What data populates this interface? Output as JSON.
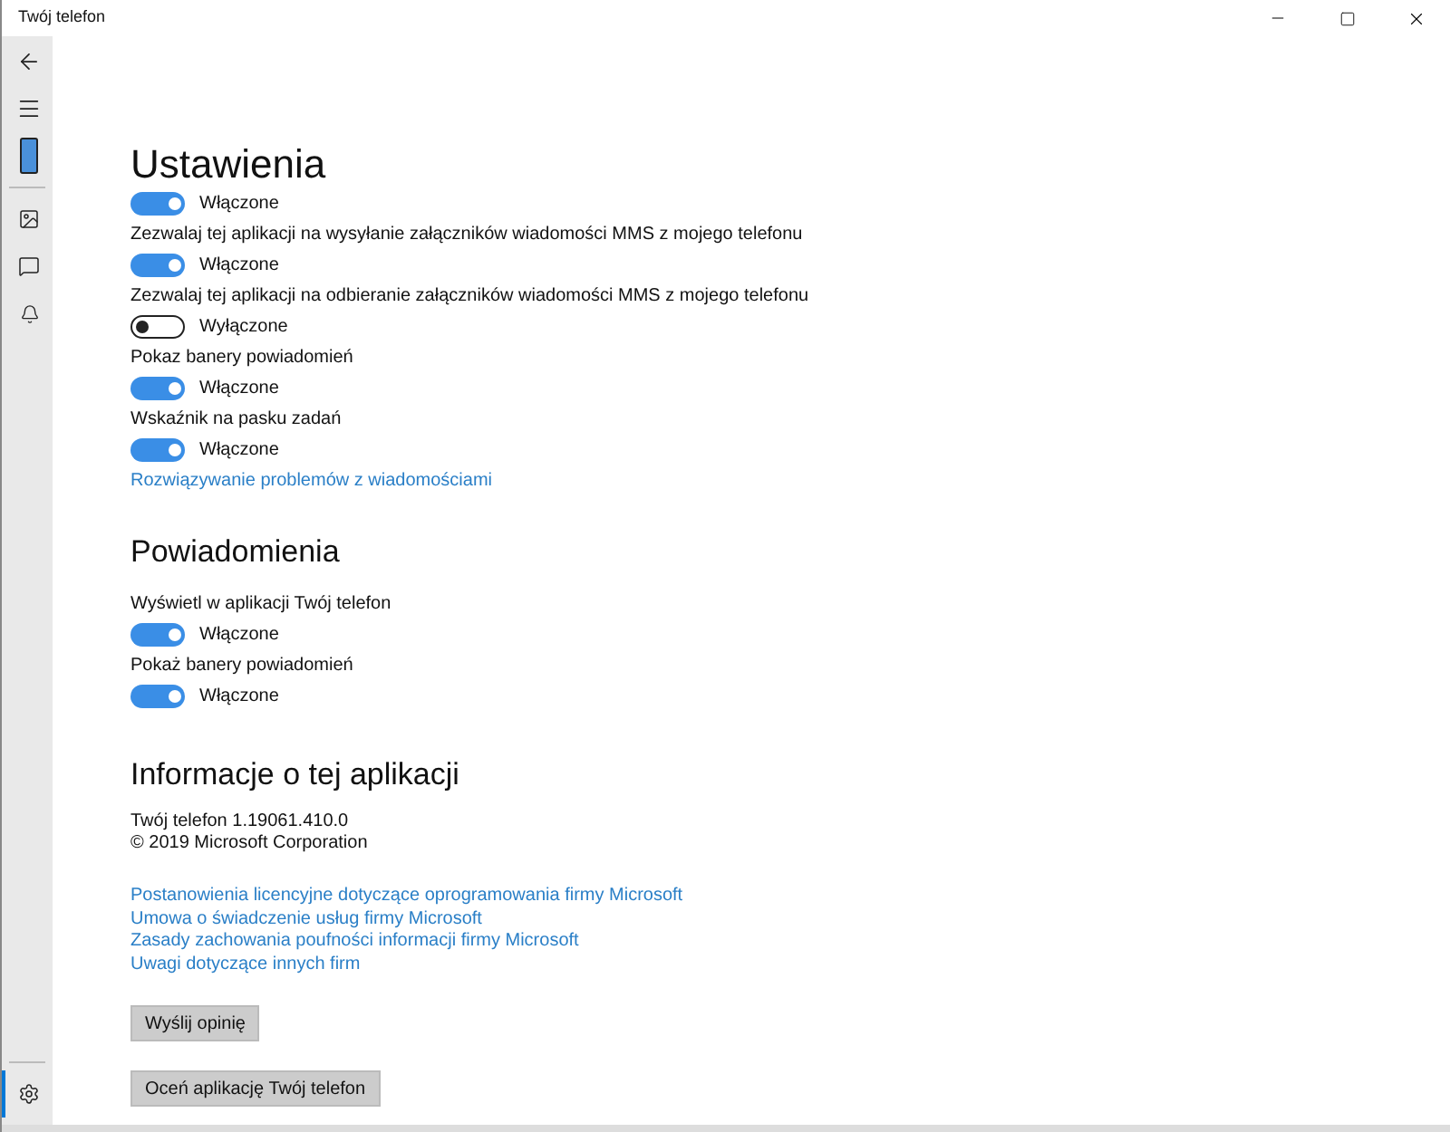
{
  "window": {
    "title": "Twój telefon"
  },
  "nav": {
    "items": [
      {
        "kind": "back",
        "selected": false
      },
      {
        "kind": "menu",
        "selected": false
      },
      {
        "kind": "phone",
        "selected": false
      },
      {
        "kind": "photos",
        "selected": false
      },
      {
        "kind": "messages",
        "selected": false
      },
      {
        "kind": "notifications",
        "selected": false
      }
    ],
    "settings_item": {
      "kind": "settings",
      "selected": true
    }
  },
  "settings": {
    "title": "Ustawienia",
    "items": [
      {
        "on": true,
        "state_text": "Włączone"
      },
      {
        "label": "Zezwalaj tej aplikacji na wysyłanie załączników wiadomości MMS z mojego telefonu",
        "on": true,
        "state_text": "Włączone"
      },
      {
        "label": "Zezwalaj tej aplikacji na odbieranie załączników wiadomości MMS z mojego telefonu",
        "on": false,
        "state_text": "Wyłączone"
      },
      {
        "label": "Pokaz banery powiadomień",
        "on": true,
        "state_text": "Włączone"
      },
      {
        "label": "Wskaźnik na pasku zadań",
        "on": true,
        "state_text": "Włączone"
      }
    ],
    "link": "Rozwiązywanie problemów z wiadomościami"
  },
  "notifications": {
    "title": "Powiadomienia",
    "items": [
      {
        "label": "Wyświetl w aplikacji Twój telefon",
        "on": true,
        "state_text": "Włączone"
      },
      {
        "label": "Pokaż banery powiadomień",
        "on": true,
        "state_text": "Włączone"
      }
    ]
  },
  "about": {
    "title": "Informacje o tej aplikacji",
    "version": "Twój telefon 1.19061.410.0",
    "copyright": "© 2019 Microsoft Corporation",
    "links": [
      "Postanowienia licencyjne dotyczące oprogramowania firmy Microsoft",
      "Umowa o świadczenie usług firmy Microsoft",
      "Zasady zachowania poufności informacji firmy Microsoft",
      "Uwagi dotyczące innych firm"
    ],
    "buttons": [
      "Wyślij opinię",
      "Oceń aplikację Twój telefon"
    ]
  }
}
